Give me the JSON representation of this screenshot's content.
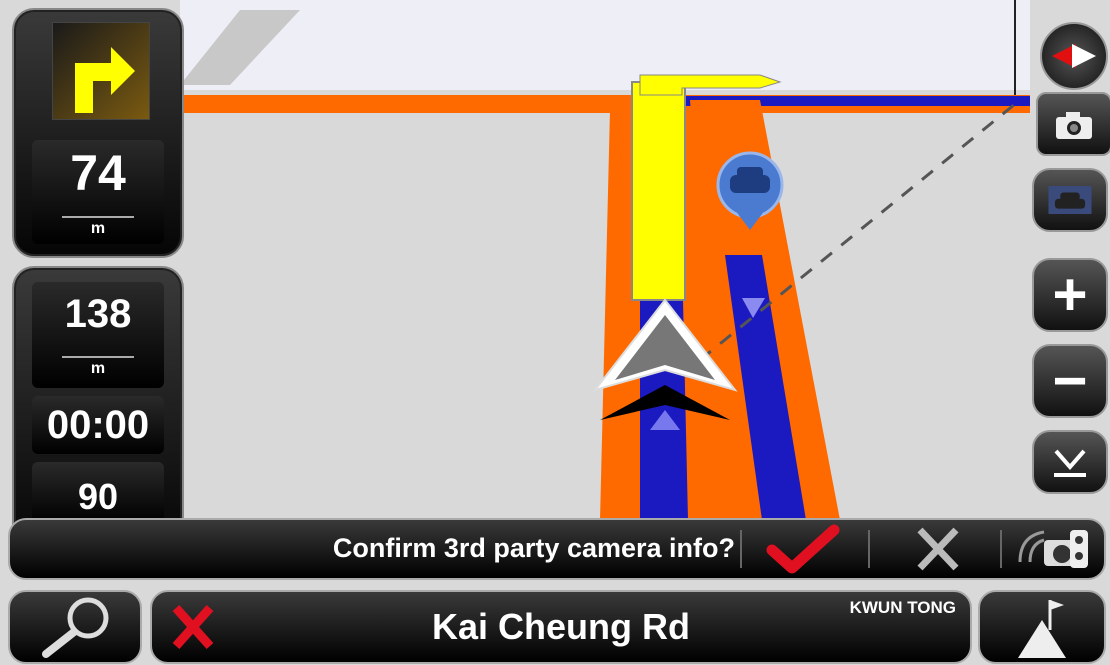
{
  "maneuver": {
    "distance_value": "74",
    "distance_unit": "m",
    "arrow_icon": "turn-right-arrow-icon"
  },
  "trip": {
    "remaining_distance_value": "138",
    "remaining_distance_unit": "m",
    "time": "00:00",
    "speed_value": "90"
  },
  "right_controls": {
    "compass_icon": "compass-icon",
    "camera_icon": "camera-icon",
    "vehicle_mode_icon": "car-icon",
    "zoom_in_label": "+",
    "zoom_out_label": "−",
    "collapse_icon": "chevron-down-icon"
  },
  "prompt": {
    "text": "Confirm 3rd party camera info?",
    "confirm_icon": "checkmark-icon",
    "cancel_icon": "close-icon",
    "camera_settings_icon": "speed-camera-icon"
  },
  "bottom_bar": {
    "search_icon": "search-icon",
    "street_name": "Kai Cheung Rd",
    "area_name": "KWUN TONG",
    "no_route_icon": "cancel-route-icon",
    "destination_icon": "destination-flag-icon"
  },
  "colors": {
    "route": "#ffff00",
    "road": "#ff6a00",
    "lane": "#1010c8",
    "map_bg": "#d9d9d9"
  }
}
